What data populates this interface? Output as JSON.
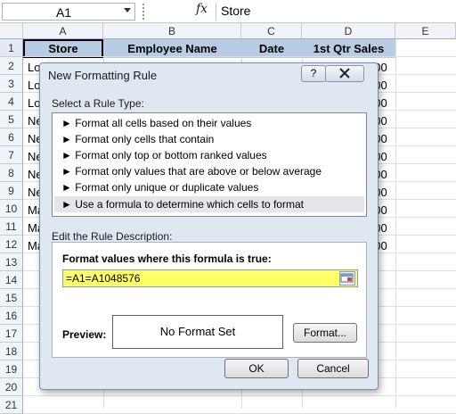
{
  "formula_bar": {
    "name_box": "A1",
    "fx_label": "fx",
    "content": "Store"
  },
  "columns": [
    "A",
    "B",
    "C",
    "D",
    "E"
  ],
  "rows": [
    "1",
    "2",
    "3",
    "4",
    "5",
    "6",
    "7",
    "8",
    "9",
    "10",
    "11",
    "12",
    "13",
    "14",
    "15",
    "16",
    "17",
    "18",
    "19",
    "20",
    "21"
  ],
  "header_row": [
    "Store",
    "Employee Name",
    "Date",
    "1st Qtr Sales"
  ],
  "visible_cell_fragments": {
    "col_a": [
      "Lor",
      "Lor",
      "Lor",
      "Ne",
      "Ne",
      "Ne",
      "Ne",
      "Ne",
      "Ma",
      "Ma",
      "Ma"
    ],
    "col_d": [
      "000",
      "000",
      "000",
      "000",
      "000",
      "000",
      "000",
      "000",
      "000",
      "000",
      "000"
    ]
  },
  "dialog": {
    "title": "New Formatting Rule",
    "help_button": "?",
    "close_button": "X",
    "select_rule_label": "Select a Rule Type:",
    "rule_types": [
      "► Format all cells based on their values",
      "► Format only cells that contain",
      "► Format only top or bottom ranked values",
      "► Format only values that are above or below average",
      "► Format only unique or duplicate values",
      "► Use a formula to determine which cells to format"
    ],
    "selected_rule_index": 5,
    "edit_description_label": "Edit the Rule Description:",
    "formula_label": "Format values where this formula is true:",
    "formula_value": "=A1=A1048576",
    "formula_highlight": "#ffff66",
    "preview_label": "Preview:",
    "preview_text": "No Format Set",
    "format_button": "Format...",
    "ok_button": "OK",
    "cancel_button": "Cancel"
  },
  "colors": {
    "header_fill": "#b8cce4",
    "dialog_bg": "#dfe7f1"
  }
}
